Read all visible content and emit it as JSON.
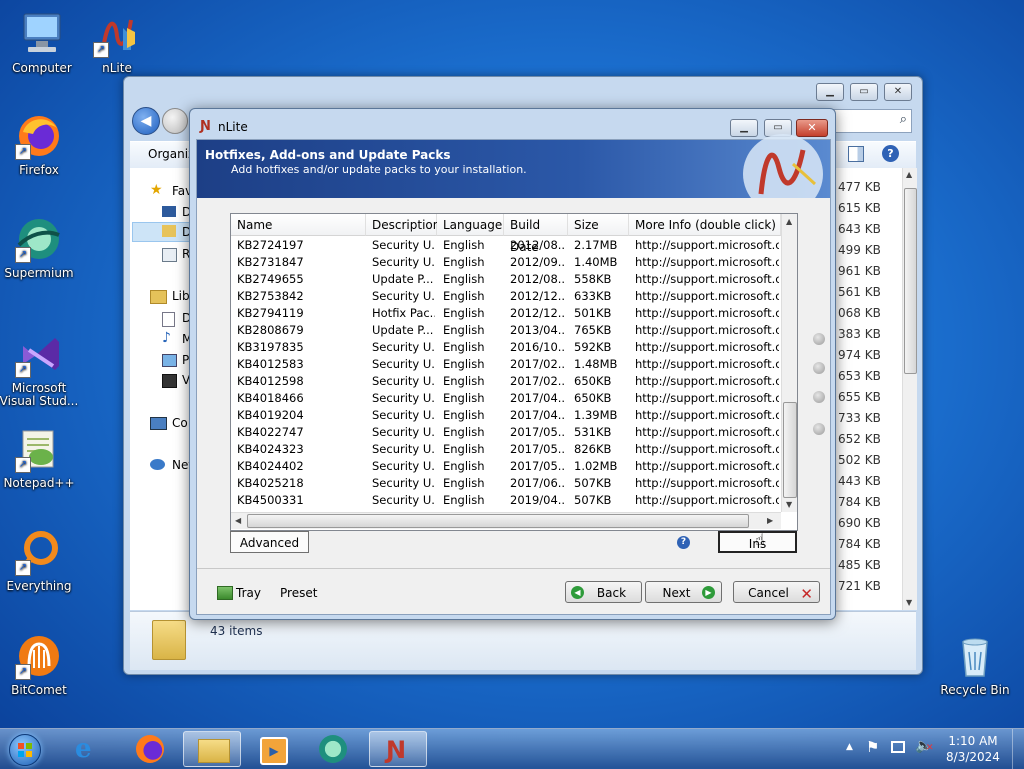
{
  "desktop": {
    "icons": [
      {
        "label": "Computer"
      },
      {
        "label": "nLite"
      },
      {
        "label": "Firefox"
      },
      {
        "label": "Supermium"
      },
      {
        "label": "Microsoft Visual Stud..."
      },
      {
        "label": "Notepad++"
      },
      {
        "label": "Everything"
      },
      {
        "label": "BitComet"
      },
      {
        "label": "Recycle Bin"
      }
    ]
  },
  "explorer": {
    "toolbar_organize": "Organiz",
    "sidebar": [
      {
        "label": "Fav"
      },
      {
        "label": "D"
      },
      {
        "label": "D"
      },
      {
        "label": "R"
      },
      {
        "label": "Lib"
      },
      {
        "label": "D"
      },
      {
        "label": "M"
      },
      {
        "label": "P"
      },
      {
        "label": "V"
      },
      {
        "label": "Co"
      },
      {
        "label": "Net"
      }
    ],
    "sizes": [
      "477 KB",
      "615 KB",
      "643 KB",
      "499 KB",
      "961 KB",
      "561 KB",
      "068 KB",
      "383 KB",
      "974 KB",
      "653 KB",
      "655 KB",
      "733 KB",
      "652 KB",
      "502 KB",
      "443 KB",
      "784 KB",
      "690 KB",
      "784 KB",
      "485 KB",
      "721 KB"
    ],
    "status_text": "43 items"
  },
  "nlite": {
    "title": "nLite",
    "banner_title": "Hotfixes, Add-ons and Update Packs",
    "banner_subtitle": "Add hotfixes and/or update packs to your installation.",
    "columns": [
      "Name",
      "Description",
      "Language",
      "Build Date",
      "Size",
      "More Info (double click)"
    ],
    "rows": [
      [
        "KB2724197",
        "Security U...",
        "English",
        "2012/08...",
        "2.17MB",
        "http://support.microsoft.com?..."
      ],
      [
        "KB2731847",
        "Security U...",
        "English",
        "2012/09...",
        "1.40MB",
        "http://support.microsoft.com?..."
      ],
      [
        "KB2749655",
        "Update P...",
        "English",
        "2012/08...",
        "558KB",
        "http://support.microsoft.com?..."
      ],
      [
        "KB2753842",
        "Security U...",
        "English",
        "2012/12...",
        "633KB",
        "http://support.microsoft.com?..."
      ],
      [
        "KB2794119",
        "Hotfix Pac...",
        "English",
        "2012/12...",
        "501KB",
        "http://support.microsoft.com?..."
      ],
      [
        "KB2808679",
        "Update P...",
        "English",
        "2013/04...",
        "765KB",
        "http://support.microsoft.com?..."
      ],
      [
        "KB3197835",
        "Security U...",
        "English",
        "2016/10...",
        "592KB",
        "http://support.microsoft.com?..."
      ],
      [
        "KB4012583",
        "Security U...",
        "English",
        "2017/02...",
        "1.48MB",
        "http://support.microsoft.com?..."
      ],
      [
        "KB4012598",
        "Security U...",
        "English",
        "2017/02...",
        "650KB",
        "http://support.microsoft.com?..."
      ],
      [
        "KB4018466",
        "Security U...",
        "English",
        "2017/04...",
        "650KB",
        "http://support.microsoft.com?..."
      ],
      [
        "KB4019204",
        "Security U...",
        "English",
        "2017/04...",
        "1.39MB",
        "http://support.microsoft.com?..."
      ],
      [
        "KB4022747",
        "Security U...",
        "English",
        "2017/05...",
        "531KB",
        "http://support.microsoft.com?..."
      ],
      [
        "KB4024323",
        "Security U...",
        "English",
        "2017/05...",
        "826KB",
        "http://support.microsoft.com?..."
      ],
      [
        "KB4024402",
        "Security U...",
        "English",
        "2017/05...",
        "1.02MB",
        "http://support.microsoft.com?..."
      ],
      [
        "KB4025218",
        "Security U...",
        "English",
        "2017/06...",
        "507KB",
        "http://support.microsoft.com?..."
      ],
      [
        "KB4500331",
        "Security U...",
        "English",
        "2019/04...",
        "507KB",
        "http://support.microsoft.com?..."
      ]
    ],
    "advanced_label": "Advanced",
    "insert_label": "Ins",
    "tray_label": "Tray",
    "preset_label": "Preset",
    "back_label": "Back",
    "next_label": "Next",
    "cancel_label": "Cancel"
  },
  "taskbar": {
    "time": "1:10 AM",
    "date": "8/3/2024"
  },
  "colors": {
    "accent": "#1d3f86",
    "back_arrow": "#2e9b3a",
    "cancel_x": "#c62828"
  }
}
